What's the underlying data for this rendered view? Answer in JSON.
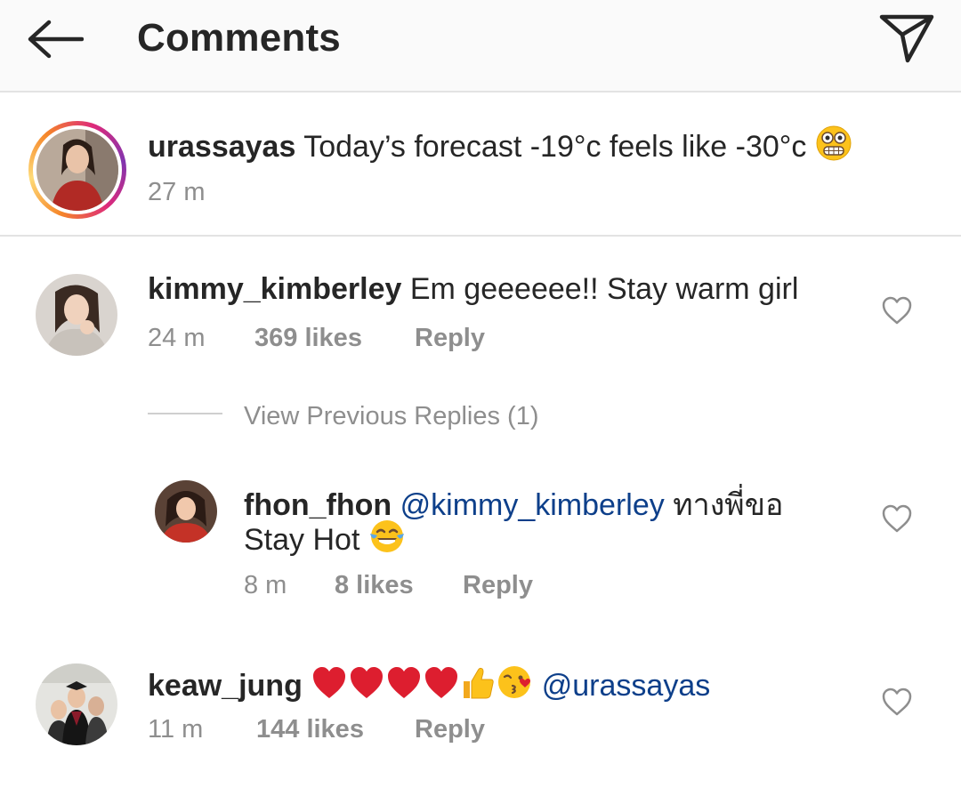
{
  "header": {
    "title": "Comments"
  },
  "caption": {
    "username": "urassayas",
    "text": "Today’s forecast -19°c feels like -30°c",
    "emoji": "grimacing-face",
    "time": "27 m"
  },
  "comments": [
    {
      "username": "kimmy_kimberley",
      "text": "Em geeeeee!! Stay warm girl",
      "time": "24 m",
      "likes": "369 likes",
      "reply": "Reply"
    },
    {
      "username": "fhon_fhon",
      "mention": "@kimmy_kimberley",
      "text_thai": "ทางพี่ขอ",
      "text2": "Stay Hot",
      "emoji": "tears-of-joy",
      "time": "8 m",
      "likes": "8 likes",
      "reply": "Reply"
    },
    {
      "username": "keaw_jung",
      "emojis": [
        "red-heart",
        "red-heart",
        "red-heart",
        "red-heart",
        "thumbs-up",
        "face-blowing-kiss"
      ],
      "mention": "@urassayas",
      "time": "11 m",
      "likes": "144 likes",
      "reply": "Reply"
    }
  ],
  "view_replies": "View Previous Replies (1)",
  "colors": {
    "header_bg": "#fafafa",
    "text": "#262626",
    "meta": "#8e8e8e",
    "mention": "#0d3f8a",
    "divider": "#e3e3e3"
  }
}
